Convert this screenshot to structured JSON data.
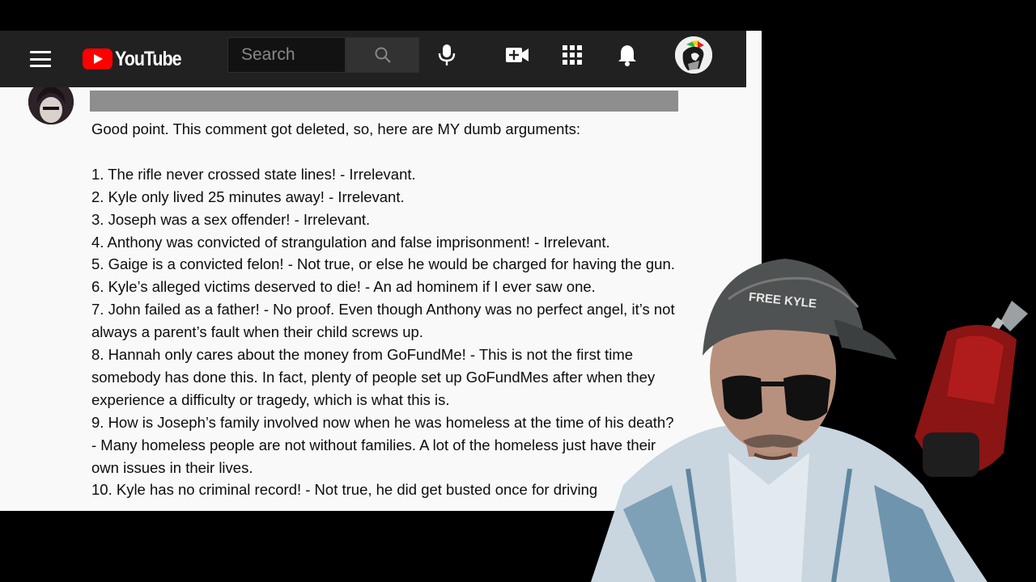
{
  "masthead": {
    "logo_text": "YouTube",
    "search_placeholder": "Search",
    "icons": [
      "menu-icon",
      "search-icon",
      "mic-icon",
      "video-create-icon",
      "apps-grid-icon",
      "bell-icon",
      "account-avatar"
    ]
  },
  "comment": {
    "intro": "Good point. This comment got deleted, so, here are MY dumb arguments:",
    "lines": [
      "1. The rifle never crossed state lines! - Irrelevant.",
      "2. Kyle only lived 25 minutes away! - Irrelevant.",
      "3. Joseph was a sex offender! - Irrelevant.",
      "4. Anthony was convicted of strangulation and false imprisonment! - Irrelevant.",
      "5. Gaige is a convicted felon! - Not true, or else he would be charged for having the gun.",
      "6. Kyle’s alleged victims deserved to die! - An ad hominem if I ever saw one.",
      "7. John failed as a father! - No proof. Even though Anthony was no perfect angel, it’s not always a parent’s fault when their child screws up.",
      "8. Hannah only cares about the money from GoFundMe! - This is not the first time somebody has done this. In fact, plenty of people set up GoFundMes after when they experience a difficulty or tragedy, which is what this is.",
      "9. How is Joseph’s family involved now when he was homeless at the time of his death? - Many homeless people are not without families. A lot of the homeless just have their own issues in their lives.",
      "10. Kyle has no criminal record! - Not true, he did get busted once for driving"
    ]
  },
  "overlay": {
    "cap_text": "FREE KYLE"
  },
  "colors": {
    "masthead_bg": "#212121",
    "logo_red": "#ff0000",
    "page_bg": "#f9f9f9",
    "redaction": "#8e8e8e"
  }
}
